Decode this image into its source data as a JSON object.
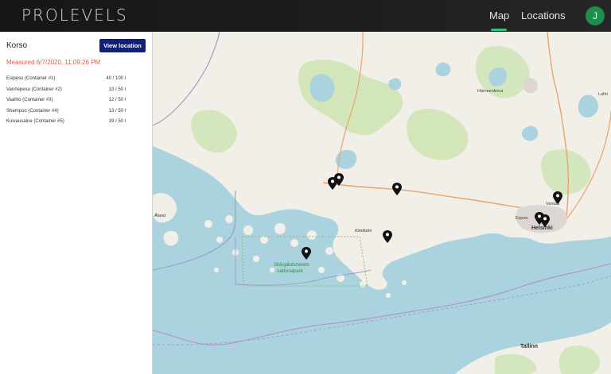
{
  "app": {
    "logo": "PROLEVELS"
  },
  "nav": {
    "map_label": "Map",
    "locations_label": "Locations"
  },
  "user": {
    "avatar_initial": "J",
    "avatar_color": "#1f8f4e"
  },
  "location": {
    "name": "Korso",
    "view_button_label": "View location",
    "measured_text": "Measured 6/7/2020, 11:09:26 PM",
    "containers": [
      {
        "name": "Esipesu (Container #1)",
        "value": "40 / 100 l"
      },
      {
        "name": "Vannepesu (Container #2)",
        "value": "13 / 50 l"
      },
      {
        "name": "Vaahto (Container #3)",
        "value": "12 / 50 l"
      },
      {
        "name": "Shampoo (Container #4)",
        "value": "13 / 50 l"
      },
      {
        "name": "Kuivausaine (Container #5)",
        "value": "19 / 50 l"
      }
    ]
  },
  "map": {
    "labels": {
      "hameenlinna": "Hämeenlinna",
      "aland": "Åland",
      "kimitoon": "Kimitoön",
      "park1": "Skärgårdshavets",
      "park2": "nationalpark",
      "espoo": "Espoo",
      "vantaa": "Vantaa",
      "helsinki": "Helsinki",
      "tallinn": "Tallinn",
      "lahti": "Lahti"
    },
    "colors": {
      "sea": "#aad3df",
      "land": "#f2efe9",
      "forest": "#cfe4b5",
      "lake": "#aad3df",
      "accent": "#0f1f7a",
      "measured": "#e35b4a"
    }
  }
}
